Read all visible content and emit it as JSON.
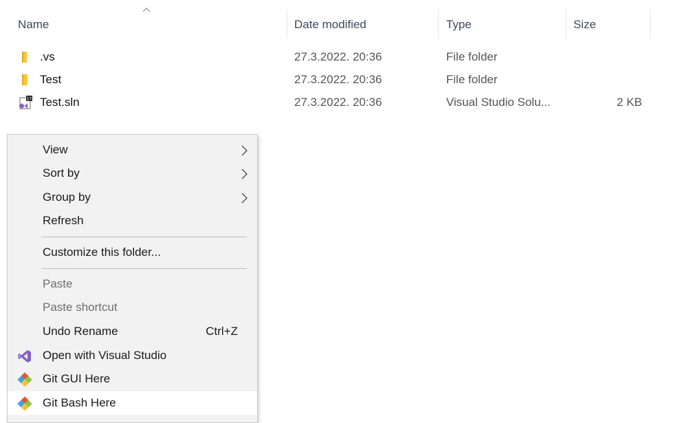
{
  "columns": {
    "name": "Name",
    "date_modified": "Date modified",
    "type": "Type",
    "size": "Size"
  },
  "files": [
    {
      "name": ".vs",
      "date": "27.3.2022. 20:36",
      "type": "File folder",
      "size": "",
      "icon": "folder-icon"
    },
    {
      "name": "Test",
      "date": "27.3.2022. 20:36",
      "type": "File folder",
      "size": "",
      "icon": "folder-icon"
    },
    {
      "name": "Test.sln",
      "date": "27.3.2022. 20:36",
      "type": "Visual Studio Solu...",
      "size": "2 KB",
      "icon": "visual-studio-solution-icon"
    }
  ],
  "context_menu": {
    "view": "View",
    "sort_by": "Sort by",
    "group_by": "Group by",
    "refresh": "Refresh",
    "customize": "Customize this folder...",
    "paste": "Paste",
    "paste_shortcut": "Paste shortcut",
    "undo_rename": "Undo Rename",
    "undo_rename_shortcut": "Ctrl+Z",
    "open_vs": "Open with Visual Studio",
    "git_gui": "Git GUI Here",
    "git_bash": "Git Bash Here"
  },
  "colors": {
    "folder": "#f8c63a",
    "visual_studio": "#865fc5",
    "git_orange": "#f05033",
    "git_green": "#8ac640",
    "git_blue": "#40a3e0",
    "git_yellow": "#f6c342"
  }
}
